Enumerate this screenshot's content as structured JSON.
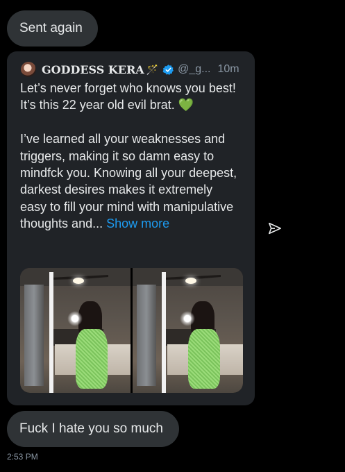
{
  "messages": {
    "first": "Sent again",
    "reply": "Fuck I hate you so much",
    "timestamp": "2:53 PM"
  },
  "quoted_post": {
    "author_name": "GODDESS KERA",
    "author_suffix": "🪄",
    "verified": true,
    "handle": "@_g...",
    "time": "10m",
    "lines": [
      "Let’s never forget who knows you best!",
      "It’s this 22 year old evil brat."
    ],
    "heart": "💚",
    "paragraph": "I’ve learned all your weaknesses and triggers, making it so damn easy to mindfck you. Knowing all your deepest, darkest desires makes it extremely easy to fill your mind with manipulative thoughts and...",
    "show_more": "Show more",
    "media_count": 2
  },
  "icons": {
    "share": "send-icon",
    "verified": "verified-badge-icon"
  },
  "colors": {
    "background": "#000000",
    "bubble": "#2f3336",
    "card": "#202327",
    "link": "#1d9bf0",
    "verified": "#1d9bf0",
    "muted": "#8b98a5"
  }
}
